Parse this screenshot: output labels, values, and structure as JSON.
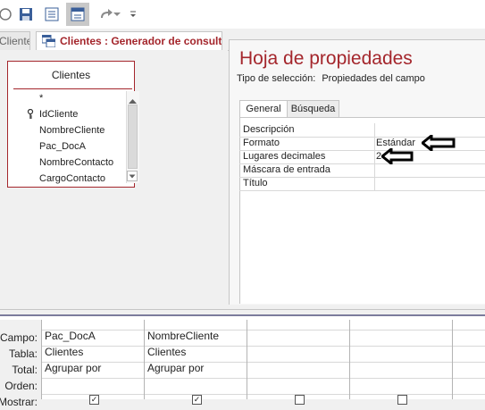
{
  "toolbar": {
    "buttons": [
      {
        "name": "save-icon"
      },
      {
        "name": "view-icon"
      },
      {
        "name": "design-view-icon",
        "active": true
      },
      {
        "name": "redo-icon"
      },
      {
        "name": "customize-toolbar-icon"
      }
    ]
  },
  "tabs": {
    "tab_a_label": "Clientes",
    "tab_b_label": "Clientes : Generador de consultas"
  },
  "table": {
    "title": "Clientes",
    "fields": [
      "*",
      "IdCliente",
      "NombreCliente",
      "Pac_DocA",
      "NombreContacto",
      "CargoContacto"
    ],
    "key_field_index": 1
  },
  "property_sheet": {
    "title": "Hoja de propiedades",
    "selection_label": "Tipo de selección:",
    "selection_value": "Propiedades del campo",
    "tabs": [
      "General",
      "Búsqueda"
    ],
    "rows": [
      {
        "name": "Descripción",
        "value": ""
      },
      {
        "name": "Formato",
        "value": "Estándar"
      },
      {
        "name": "Lugares decimales",
        "value": "2"
      },
      {
        "name": "Máscara de entrada",
        "value": ""
      },
      {
        "name": "Título",
        "value": ""
      }
    ]
  },
  "query_grid": {
    "row_labels": [
      "Campo:",
      "Tabla:",
      "Total:",
      "Orden:",
      "Mostrar:"
    ],
    "columns": [
      {
        "campo": "Pac_DocA",
        "tabla": "Clientes",
        "total": "Agrupar por",
        "mostrar": true
      },
      {
        "campo": "NombreCliente",
        "tabla": "Clientes",
        "total": "Agrupar por",
        "mostrar": true
      },
      {
        "campo": "",
        "tabla": "",
        "total": "",
        "mostrar": false
      },
      {
        "campo": "",
        "tabla": "",
        "total": "",
        "mostrar": false
      }
    ]
  },
  "colors": {
    "accent": "#a4262c",
    "arrow": "#000000"
  }
}
